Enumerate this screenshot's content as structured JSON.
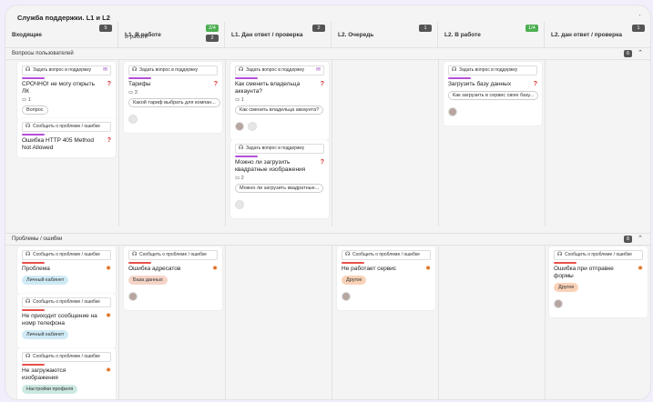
{
  "board": {
    "title": "Служба поддержки. L1 и L2",
    "menu": "·"
  },
  "columns": [
    {
      "name": "Входящие",
      "count": "5",
      "green": false
    },
    {
      "name": "L1. В работе",
      "count": "2/4",
      "green": true,
      "sub": "В работе",
      "sub_count": "2"
    },
    {
      "name": "L1. Дан ответ / проверка",
      "count": "2",
      "green": false
    },
    {
      "name": "L2. Очередь",
      "count": "1",
      "green": false
    },
    {
      "name": "L2. В работе",
      "count": "1/4",
      "green": true
    },
    {
      "name": "L2. дан ответ / проверка",
      "count": "1",
      "green": false
    }
  ],
  "lanes": {
    "questions": {
      "name": "Вопросы пользователей",
      "count": "6",
      "chevron": "⌃"
    },
    "problems": {
      "name": "Проблемы / ошибки",
      "count": "8",
      "chevron": "⌃"
    }
  },
  "tags": {
    "ask": "Задать вопрос в поддержку",
    "report": "Сообщить о проблеме / ошибке"
  },
  "cards": {
    "q1": {
      "title": "СРОЧНО! не могу открыть ЛК",
      "comments": "1",
      "pill": "Вопрос"
    },
    "q2": {
      "title": "Ошибка HTTP 405 Method Not Allowed"
    },
    "q3": {
      "title": "Тарифы",
      "comments": "3",
      "pill": "Какой тариф выбрать для компан..."
    },
    "q4": {
      "title": "Как сменить владельца аккаунта?",
      "comments": "1",
      "pill": "Как сменить владельца аккаунта?"
    },
    "q5": {
      "title": "Можно ли загрузить квадратные изображения",
      "comments": "2",
      "pill": "Можно ли загрузить квадратные..."
    },
    "q6": {
      "title": "Загрузить базу данных",
      "pill": "Как загрузить в сервис свою базу..."
    },
    "p1": {
      "title": "Проблема",
      "pill": "Личный кабинет"
    },
    "p2": {
      "title": "Не приходит сообщение на номр телефона",
      "pill": "Личный кабинет"
    },
    "p3": {
      "title": "Не загружаются изображения",
      "pill": "Настройки профиля"
    },
    "p4": {
      "title": "Ошибка адресатов",
      "pill": "База данных"
    },
    "p5": {
      "title": "Не работает сервис",
      "pill": "Другое"
    },
    "p6": {
      "title": "Ошибка при отправке формы",
      "pill": "Другое"
    }
  },
  "colors": {
    "purple": "#b550d8",
    "red": "#e8504a",
    "green": "#4caf50"
  }
}
